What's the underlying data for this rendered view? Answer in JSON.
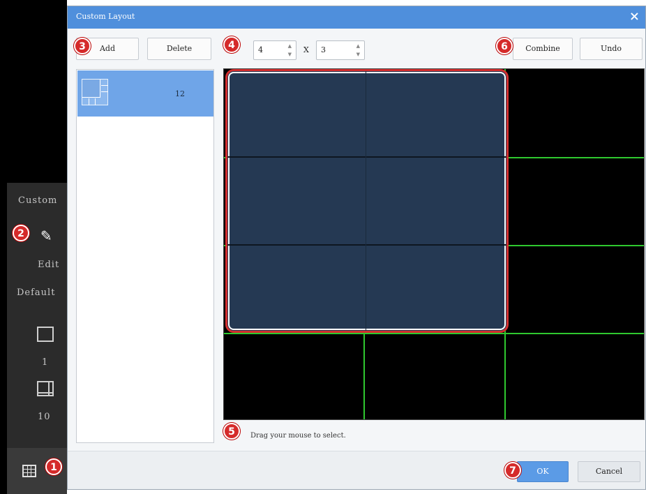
{
  "background_app": {
    "custom_label": "Custom",
    "edit_label": "Edit",
    "default_label": "Default",
    "layout_1_count": "1",
    "layout_10_count": "10"
  },
  "dialog": {
    "title": "Custom Layout",
    "close_glyph": "×",
    "toolbar": {
      "add_label": "Add",
      "delete_label": "Delete",
      "rows_value": "4",
      "cols_separator": "X",
      "cols_value": "3",
      "combine_label": "Combine",
      "undo_label": "Undo"
    },
    "layout_list": [
      {
        "count": "12"
      }
    ],
    "hint": "Drag your mouse to select.",
    "footer": {
      "ok_label": "OK",
      "cancel_label": "Cancel"
    }
  },
  "callouts": [
    "1",
    "2",
    "3",
    "4",
    "5",
    "6",
    "7"
  ],
  "colors": {
    "titlebar": "#4f8fdc",
    "selected_item": "#6fa5e8",
    "grid_line": "#2fc92f",
    "selection_fill": "#253953",
    "callout": "#d52a2a"
  }
}
